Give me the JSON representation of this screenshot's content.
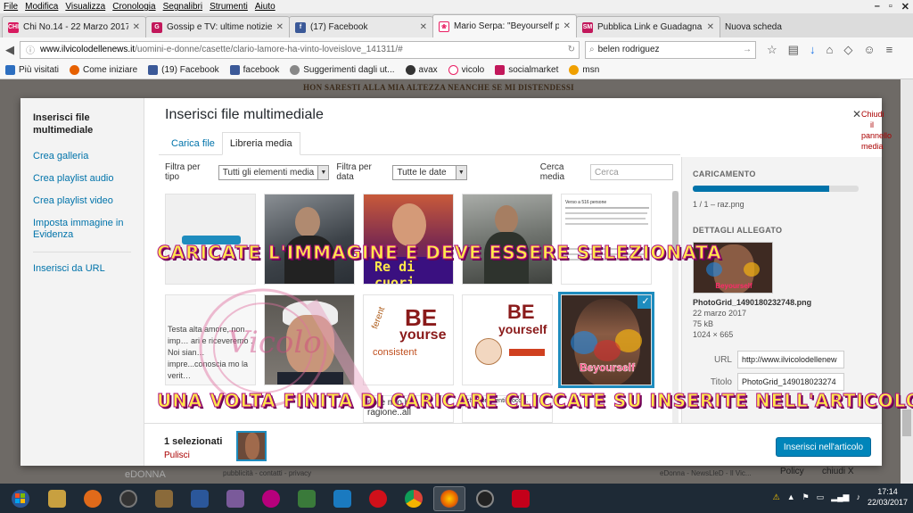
{
  "menu": [
    "File",
    "Modifica",
    "Visualizza",
    "Cronologia",
    "Segnalibri",
    "Strumenti",
    "Aiuto"
  ],
  "tabs": [
    {
      "label": "Chi No.14 - 22 Marzo 2017 ...",
      "color": "#d81b60",
      "fav": "CHI"
    },
    {
      "label": "Gossip e TV: ultime notizie ...",
      "color": "#c2185b",
      "fav": "G"
    },
    {
      "label": "(17) Facebook",
      "color": "#3b5998",
      "fav": "f"
    },
    {
      "label": "Mario Serpa: \"Beyourself p...",
      "color": "#e91e63",
      "fav": "❀"
    },
    {
      "label": "Pubblica Link e Guadagna ...",
      "color": "#c2185b",
      "fav": "SM"
    },
    {
      "label": "Nuova scheda",
      "color": "transparent",
      "fav": ""
    }
  ],
  "url": {
    "domain": "www.ilvicolodellenews.it",
    "path": "/uomini-e-donne/casette/clario-lamore-ha-vinto-loveislove_141311/#"
  },
  "search_query": "belen rodriguez",
  "bookmarks": [
    "Più visitati",
    "Come iniziare",
    "(19) Facebook",
    "facebook",
    "Suggerimenti dagli ut...",
    "avax",
    "vicolo",
    "socialmarket",
    "msn"
  ],
  "page": {
    "topline": "HON SARESTI ALLA MIA ALTEZZA NEANCHE SE MI DISTENDESSI",
    "footer_left": "eDONNA",
    "footer_mid": "pubblicità - contatti - privacy",
    "footer_right": "eDonna - NewsLleD - Il Vic...",
    "footer_far": "Policy",
    "footer_close": "chiudi X"
  },
  "modal": {
    "title": "Inserisci file multimediale",
    "close_label": "Chiudi il pannello media",
    "sidebar": {
      "title": "Inserisci file multimediale",
      "links": [
        "Crea galleria",
        "Crea playlist audio",
        "Crea playlist video",
        "Imposta immagine in Evidenza"
      ],
      "url_link": "Inserisci da URL"
    },
    "tabs": [
      "Carica file",
      "Libreria media"
    ],
    "filters": {
      "type_label": "Filtra per tipo",
      "type_value": "Tutti gli elementi media",
      "date_label": "Filtra per data",
      "date_value": "Tutte le date",
      "search_label": "Cerca media",
      "search_placeholder": "Cerca"
    },
    "upload": {
      "heading": "CARICAMENTO",
      "progress": 0.82,
      "count": "1 / 1",
      "separator": "–",
      "file": "raz.png"
    },
    "details": {
      "heading": "DETTAGLI ALLEGATO",
      "filename": "PhotoGrid_1490180232748.png",
      "date": "22 marzo 2017",
      "size": "75 kB",
      "dimensions": "1024 × 665",
      "url_label": "URL",
      "url_value": "http://www.ilvicolodellenew",
      "title_label": "Titolo",
      "title_value": "PhotoGrid_149018023274"
    },
    "footer": {
      "selected": "1 selezionati",
      "clear": "Pulisci",
      "insert": "Inserisci nell'articolo"
    },
    "thumb_texts": {
      "t2": "Re di cuori",
      "t6": "Testa alta amore, non imp… ari e riceveremo . Noi sian… impre...conoscia mo la verit…",
      "t8a": "BE",
      "t8b": "yourse",
      "t8c": "consistent",
      "t9a": "BE",
      "t9b": "yourself",
      "t10": "Beyourself",
      "t7bottom": "nore mio hai ragione..all",
      "t9bottom": "che commenti bloccc..",
      "t5": "Verso a 516 persone"
    }
  },
  "captions": {
    "top": "CARICATE L'IMMAGINE E DEVE ESSERE SELEZIONATA",
    "bottom": "UNA VOLTA FINITA DI CARICARE CLICCATE SU INSERITE NELL'ARTICOLO"
  },
  "taskbar": {
    "time": "17:14",
    "date": "22/03/2017"
  }
}
